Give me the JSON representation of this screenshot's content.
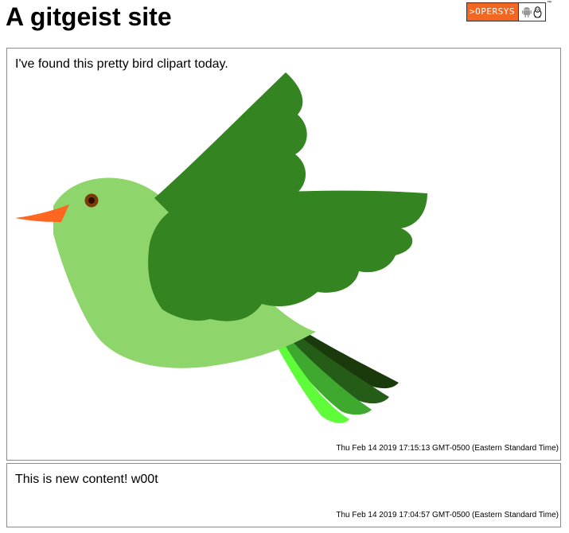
{
  "header": {
    "title": "A gitgeist site",
    "logo": {
      "text": ">OPERSYS",
      "icons": [
        "android-icon",
        "linux-penguin-icon"
      ],
      "trademark": "™",
      "accent_color": "#f26722"
    }
  },
  "posts": [
    {
      "text": "I've found this pretty bird clipart today.",
      "date": "Thu Feb 14 2019 17:15:13 GMT-0500 (Eastern Standard Time)",
      "image": "bird-illustration"
    },
    {
      "text": "This is new content! w00t",
      "date": "Thu Feb 14 2019 17:04:57 GMT-0500 (Eastern Standard Time)"
    }
  ],
  "colors": {
    "bird_body": "#8ed66c",
    "bird_wing": "#358422",
    "bird_beak": "#ff6620",
    "tail_dark": "#1a3a0c",
    "tail_mid": "#245c18",
    "tail_light": "#3fa82e",
    "tail_bright": "#5ffc3a"
  }
}
